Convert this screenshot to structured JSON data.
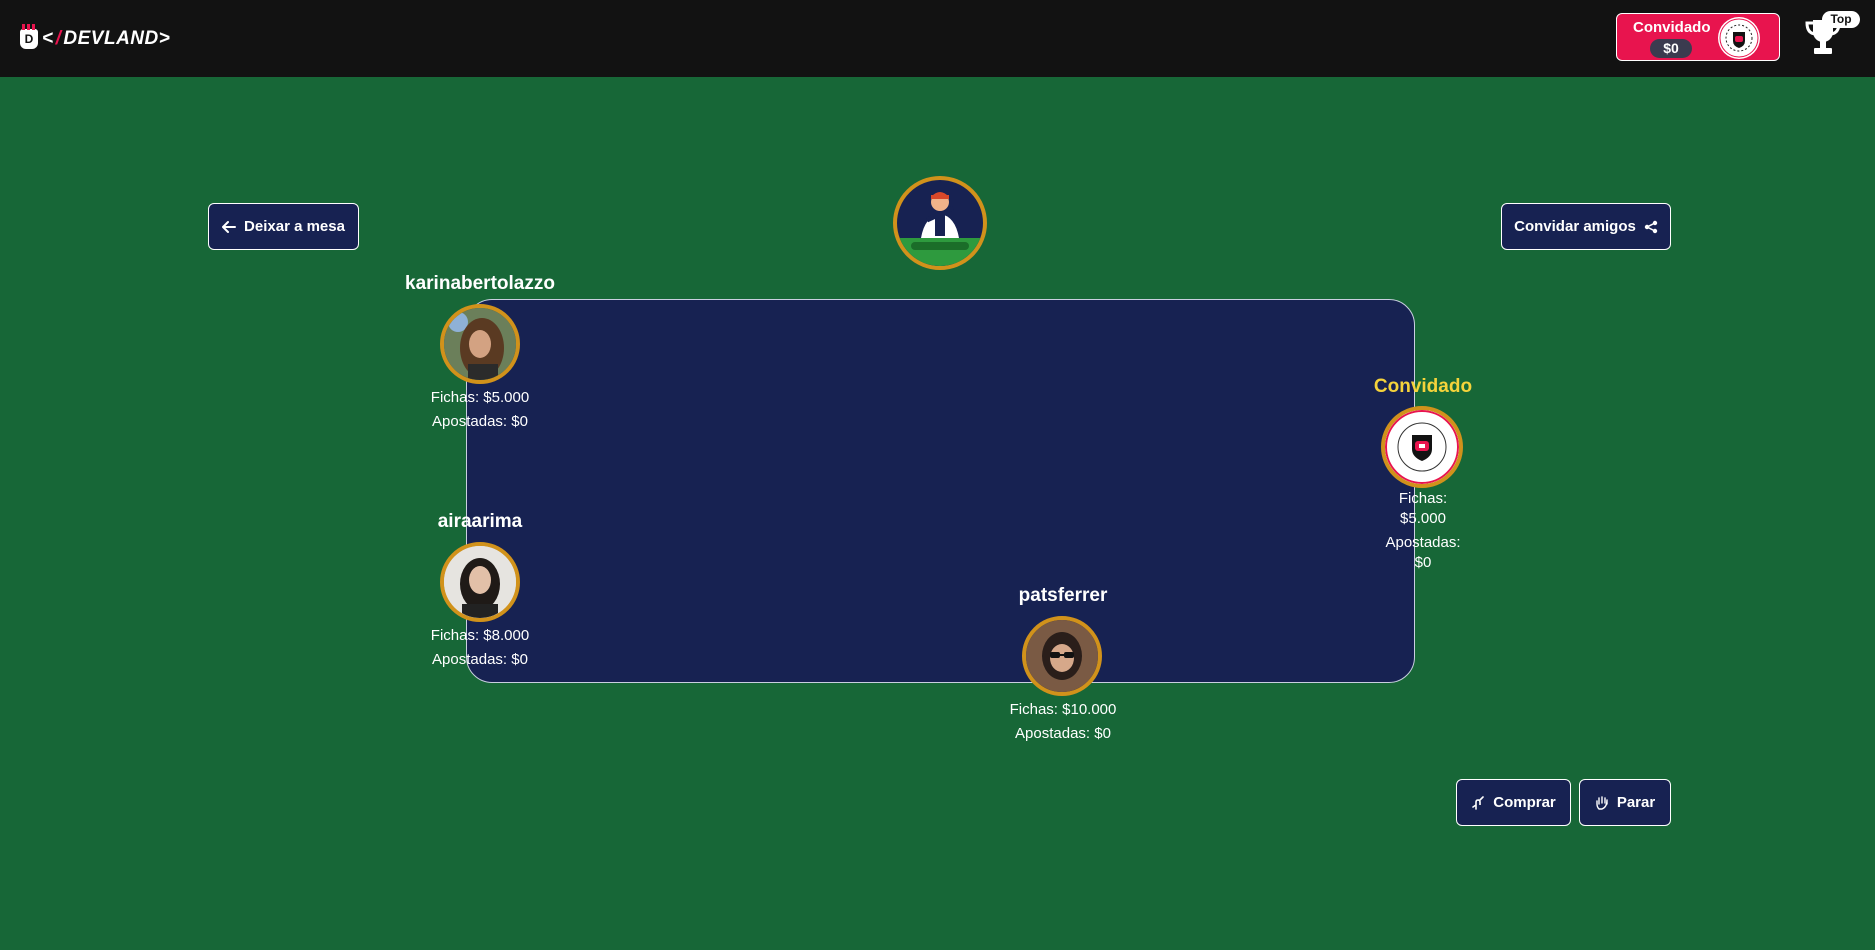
{
  "header": {
    "logo_text": "DEVLAND",
    "user": {
      "name": "Convidado",
      "balance": "$0"
    },
    "trophy_badge": "Top"
  },
  "actions": {
    "leave_table": "Deixar a mesa",
    "invite_friends": "Convidar amigos",
    "buy": "Comprar",
    "stand": "Parar"
  },
  "players": [
    {
      "name": "karinabertolazzo",
      "chips": "Fichas: $5.000",
      "bet": "Apostadas: $0"
    },
    {
      "name": "airaarima",
      "chips": "Fichas: $8.000",
      "bet": "Apostadas: $0"
    },
    {
      "name": "patsferrer",
      "chips": "Fichas: $10.000",
      "bet": "Apostadas: $0"
    },
    {
      "name": "Convidado",
      "chips_label": "Fichas:",
      "chips_value": "$5.000",
      "bet_label": "Apostadas:",
      "bet_value": "$0"
    }
  ],
  "colors": {
    "background": "#176737",
    "header": "#121212",
    "table": "#172252",
    "accent": "#e8144e",
    "avatar_ring": "#d1921b",
    "current_player": "#f5d33b"
  }
}
